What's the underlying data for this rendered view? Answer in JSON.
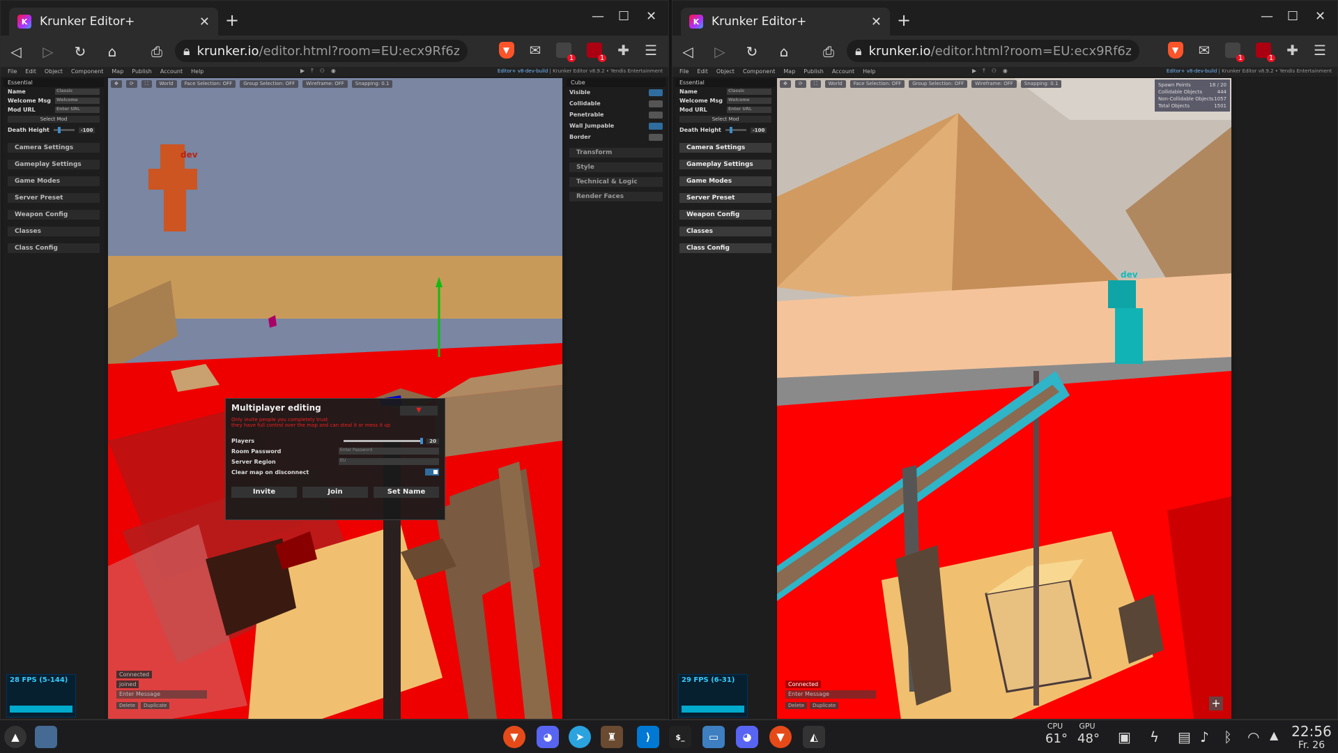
{
  "browser": {
    "tab_title": "Krunker Editor+",
    "tab_close": "✕",
    "new_tab": "+",
    "url_domain": "krunker.io",
    "url_path": "/editor.html?room=EU:ecx9Rf6z...",
    "ext_badge": "1",
    "window_controls": [
      "—",
      "☐",
      "✕"
    ]
  },
  "editor": {
    "menu": [
      "File",
      "Edit",
      "Object",
      "Component",
      "Map",
      "Publish",
      "Account",
      "Help"
    ],
    "version_prefix": "Editor+ v8-dev-build",
    "version_suffix": "| Krunker Editor v8.9.2 • Yendis Entertainment",
    "essential_header": "Essential",
    "fields": [
      {
        "label": "Name",
        "value": "Classic"
      },
      {
        "label": "Welcome Msg",
        "value": "Welcome"
      },
      {
        "label": "Mod URL",
        "value": "Enter URL"
      }
    ],
    "select_mod": "Select Mod",
    "death_height_label": "Death Height",
    "death_height_value": "-100",
    "sections": [
      "Camera Settings",
      "Gameplay Settings",
      "Game Modes",
      "Server Preset",
      "Weapon Config",
      "Classes",
      "Class Config"
    ],
    "viewport_toolbar": [
      "World",
      "Face Selection: OFF",
      "Group Selection: OFF",
      "Wireframe: OFF",
      "Snapping: 0.1"
    ],
    "chat": {
      "connected": "Connected",
      "joined": "joined",
      "placeholder": "Enter Message",
      "delete": "Delete",
      "duplicate": "Duplicate"
    },
    "player_tag": "dev"
  },
  "left": {
    "fps": "28 FPS (5-144)",
    "right_panel_header": "Cube",
    "toggles": [
      {
        "label": "Visible",
        "on": true
      },
      {
        "label": "Collidable",
        "on": false
      },
      {
        "label": "Penetrable",
        "on": false
      },
      {
        "label": "Wall Jumpable",
        "on": true
      },
      {
        "label": "Border",
        "on": false
      }
    ],
    "right_sections": [
      "Transform",
      "Style",
      "Technical & Logic",
      "Render Faces"
    ],
    "dialog": {
      "title": "Multiplayer editing",
      "warning_line1": "Only invite people you completely trust",
      "warning_line2": "they have full control over the map and can steal it or mess it up",
      "players_label": "Players",
      "players_value": "20",
      "room_password_label": "Room Password",
      "room_password_placeholder": "Enter Password",
      "server_region_label": "Server Region",
      "server_region_value": "EU",
      "clear_map_label": "Clear map on disconnect",
      "invite_button": "Invite",
      "join_button": "Join",
      "setname_button": "Set Name"
    }
  },
  "right": {
    "fps": "29 FPS (6-31)",
    "stats": [
      {
        "label": "Spawn Points",
        "value": "18 / 20"
      },
      {
        "label": "Collidable Objects",
        "value": "444"
      },
      {
        "label": "Non-Collidable Objects",
        "value": "1057"
      },
      {
        "label": "Total Objects",
        "value": "1501"
      }
    ],
    "plus": "+"
  },
  "taskbar": {
    "cpu_label": "CPU",
    "cpu_value": "61°",
    "gpu_label": "GPU",
    "gpu_value": "48°",
    "time": "22:56",
    "date": "Fr. 26",
    "terminal": "$_"
  },
  "colors": {
    "red": "#ff0000",
    "sand": "#f0c070",
    "sky": "#7a86a2",
    "accent": "#2f6d9e"
  }
}
